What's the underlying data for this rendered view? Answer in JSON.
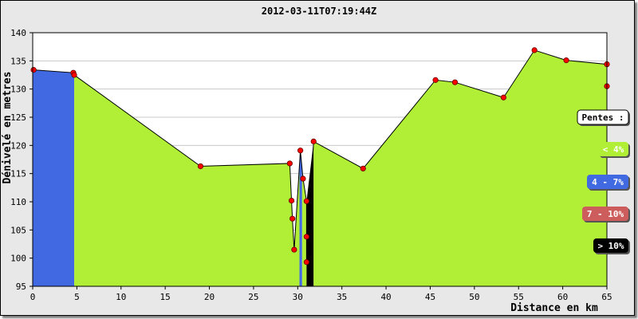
{
  "chart_data": {
    "type": "area",
    "title": "2012-03-11T07:19:44Z",
    "xlabel": "Distance en km",
    "ylabel": "Dénivelé en metres",
    "xlim": [
      0,
      65
    ],
    "ylim": [
      95,
      140
    ],
    "x_ticks": [
      0,
      5,
      10,
      15,
      20,
      25,
      30,
      35,
      40,
      45,
      50,
      55,
      60,
      65
    ],
    "y_ticks": [
      95,
      100,
      105,
      110,
      115,
      120,
      125,
      130,
      135,
      140
    ],
    "grid": "horizontal",
    "points": [
      {
        "x": 0.1,
        "y": 133.4,
        "slope": "4-7%"
      },
      {
        "x": 4.6,
        "y": 132.9,
        "slope": "4-7%"
      },
      {
        "x": 4.7,
        "y": 132.5,
        "slope": "<4%"
      },
      {
        "x": 19.0,
        "y": 116.3,
        "slope": "<4%"
      },
      {
        "x": 29.1,
        "y": 116.8,
        "slope": "<4%"
      },
      {
        "x": 29.3,
        "y": 110.2,
        "slope": "<4%"
      },
      {
        "x": 29.4,
        "y": 107.0,
        "slope": "<4%"
      },
      {
        "x": 29.6,
        "y": 101.5,
        "slope": "<4%"
      },
      {
        "x": 30.3,
        "y": 119.1,
        "slope": "4-7%"
      },
      {
        "x": 30.6,
        "y": 114.1,
        "slope": "<4%"
      },
      {
        "x": 31.0,
        "y": 110.1,
        "slope": "<4%"
      },
      {
        "x": 31.0,
        "y": 103.8,
        "slope": "<4%"
      },
      {
        "x": 31.0,
        "y": 99.3,
        "slope": ">10%"
      },
      {
        "x": 31.8,
        "y": 120.7,
        "slope": "<4%"
      },
      {
        "x": 37.4,
        "y": 115.9,
        "slope": "<4%"
      },
      {
        "x": 45.6,
        "y": 131.6,
        "slope": "<4%"
      },
      {
        "x": 47.8,
        "y": 131.2,
        "slope": "<4%"
      },
      {
        "x": 53.3,
        "y": 128.5,
        "slope": "<4%"
      },
      {
        "x": 56.8,
        "y": 136.9,
        "slope": "<4%"
      },
      {
        "x": 60.4,
        "y": 135.1,
        "slope": "<4%"
      },
      {
        "x": 65.0,
        "y": 134.4,
        "slope": "<4%"
      },
      {
        "x": 65.0,
        "y": 130.5,
        "slope": "<4%"
      }
    ],
    "fills": [
      {
        "from": 0,
        "to": 4.7,
        "slope": "4-7%"
      },
      {
        "from": 4.7,
        "to": 30.2,
        "slope": "<4%"
      },
      {
        "from": 30.2,
        "to": 30.5,
        "slope": "4-7%"
      },
      {
        "from": 30.5,
        "to": 31.0,
        "slope": "<4%"
      },
      {
        "from": 31.0,
        "to": 31.8,
        "slope": ">10%"
      },
      {
        "from": 31.8,
        "to": 65,
        "slope": "<4%"
      }
    ],
    "legend": {
      "title": "Pentes :",
      "placement": "right",
      "entries": [
        {
          "label": "< 4%",
          "key": "<4%",
          "color": "#b0ef36",
          "text_color": "#ffffff"
        },
        {
          "label": "4 - 7%",
          "key": "4-7%",
          "color": "#4169e1",
          "text_color": "#ffffff"
        },
        {
          "label": "7 - 10%",
          "key": "7-10%",
          "color": "#cd5c5c",
          "text_color": "#ffffff"
        },
        {
          "label": "> 10%",
          "key": ">10%",
          "color": "#000000",
          "text_color": "#ffffff"
        }
      ]
    },
    "colors": {
      "marker": "#ff0000",
      "line": "#000000",
      "grid": "#c8c8c8",
      "plot_bg": "#ffffff",
      "frame_bg": "#e8e8e8"
    }
  }
}
